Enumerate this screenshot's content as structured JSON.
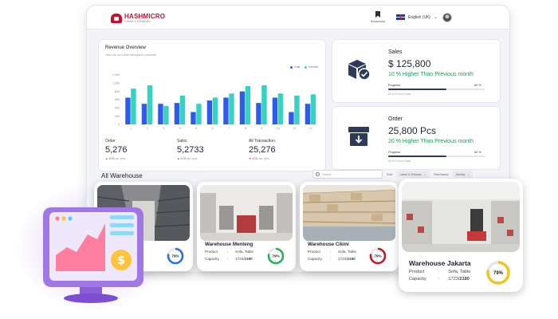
{
  "header": {
    "logo_name": "HASHMICRO",
    "logo_tagline": "THINK FORWARD",
    "bookmark_label": "Bookmark",
    "language": "English (UK)"
  },
  "revenue": {
    "title": "Revenue Overview",
    "subtitle": "Here can be a little description comment",
    "legend": [
      {
        "name": "Cost",
        "color": "#2f5bea"
      },
      {
        "name": "Income",
        "color": "#36d3c1"
      }
    ]
  },
  "chart_data": {
    "type": "bar",
    "categories": [
      "1",
      "2",
      "3",
      "4",
      "5",
      "6",
      "7",
      "8",
      "9",
      "10",
      "11",
      "12"
    ],
    "series": [
      {
        "name": "Cost",
        "values": [
          650,
          500,
          500,
          520,
          300,
          580,
          650,
          800,
          520,
          650,
          300,
          500
        ]
      },
      {
        "name": "Income",
        "values": [
          870,
          950,
          450,
          700,
          500,
          650,
          750,
          930,
          950,
          750,
          700,
          730
        ]
      }
    ],
    "yticks": [
      "0",
      "200",
      "400",
      "600",
      "800",
      "1,000",
      "1,200"
    ],
    "ylim": [
      0,
      1200
    ]
  },
  "kpis": [
    {
      "label": "Order",
      "value": "5,276",
      "delta": "8.05",
      "delta_note": "per year",
      "direction": "up"
    },
    {
      "label": "Sales",
      "value": "5,2733",
      "delta": "8.05",
      "delta_note": "per year",
      "direction": "up"
    },
    {
      "label": "All Transaction",
      "value": "25,276",
      "delta": "8.05",
      "delta_note": "per year",
      "direction": "down"
    }
  ],
  "sales": {
    "title": "Sales",
    "value": "$ 125,800",
    "change": "10 % Higher Than Previous month",
    "progress_label": "Progress",
    "progress_pct_text": "60 %",
    "progress": 0.6,
    "note": "60 % Of Your Goals"
  },
  "order": {
    "title": "Order",
    "value": "25,800 Pcs",
    "change": "20 % Higher Than Previous month",
    "progress_label": "Progress",
    "progress_pct_text": "60 %",
    "progress": 0.6,
    "note": "60 % Of Your Goals"
  },
  "warehouse": {
    "title": "All Warehouse",
    "search_placeholder": "Search...",
    "filter_label_1": "Sort",
    "filter_value_1": "Latest & Release",
    "filter_label_2": "Timeframe",
    "filter_value_2": "Weekly",
    "cards": [
      {
        "name": "",
        "percent": "79%",
        "percent_value": 0.79,
        "product_label": "",
        "product": "",
        "capacity_label": "",
        "capacity": "",
        "ring_color": "#2f6bea"
      },
      {
        "name": "Warehouse Menteng",
        "percent": "79%",
        "percent_value": 0.79,
        "product_label": "Product",
        "product": "Sofa, Table",
        "capacity_label": "Capacity",
        "capacity": "1723/2180",
        "ring_color": "#23b25a"
      },
      {
        "name": "Warehouse Cikini",
        "percent": "79%",
        "percent_value": 0.79,
        "product_label": "Product",
        "product": "Sofa, Table",
        "capacity_label": "Capacity",
        "capacity": "1723/2180",
        "ring_color": "#c0182e"
      },
      {
        "name": "Warehouse Jakarta",
        "percent": "79%",
        "percent_value": 0.79,
        "product_label": "Product",
        "product": "Sofa, Table",
        "capacity_label": "Capacity",
        "capacity": "1723/2180",
        "ring_color": "#f2c318"
      }
    ]
  }
}
